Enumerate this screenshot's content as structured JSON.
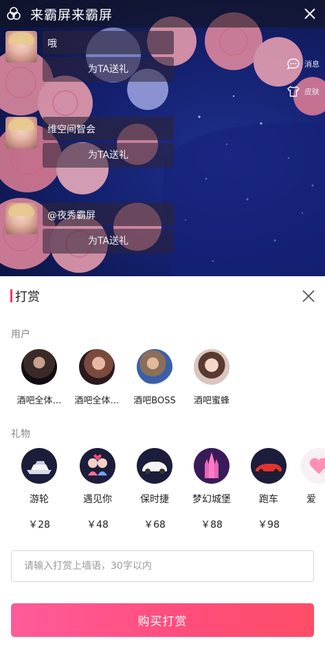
{
  "top_bar": {
    "title": "来霸屏来霸屏"
  },
  "side_actions": [
    {
      "label": "消息",
      "icon": "chat-bubble-icon"
    },
    {
      "label": "皮肤",
      "icon": "tshirt-icon"
    }
  ],
  "messages": [
    {
      "text": "哦",
      "gift_label": "为TA送礼"
    },
    {
      "text": "维空间智会",
      "gift_label": "为TA送礼"
    },
    {
      "text": "@夜秀霸屏",
      "gift_label": "为TA送礼"
    }
  ],
  "sheet": {
    "title": "打赏",
    "users_label": "用户",
    "gifts_label": "礼物",
    "accent_color": "#f0386b"
  },
  "users": [
    {
      "name": "酒吧全体…"
    },
    {
      "name": "酒吧全体…"
    },
    {
      "name": "酒吧BOSS"
    },
    {
      "name": "酒吧蜜蜂"
    }
  ],
  "gifts": [
    {
      "name": "游轮",
      "price": "￥28",
      "icon": "yacht-icon"
    },
    {
      "name": "遇见你",
      "price": "￥48",
      "icon": "couple-icon"
    },
    {
      "name": "保时捷",
      "price": "￥68",
      "icon": "sports-car-icon"
    },
    {
      "name": "梦幻城堡",
      "price": "￥88",
      "icon": "castle-icon"
    },
    {
      "name": "跑车",
      "price": "￥98",
      "icon": "red-car-icon"
    },
    {
      "name": "爱",
      "price": "",
      "icon": "heart-icon"
    }
  ],
  "wish_input": {
    "placeholder": "请输入打赏上墙语，30字以内",
    "value": ""
  },
  "buy_button": {
    "label": "购买打赏"
  }
}
